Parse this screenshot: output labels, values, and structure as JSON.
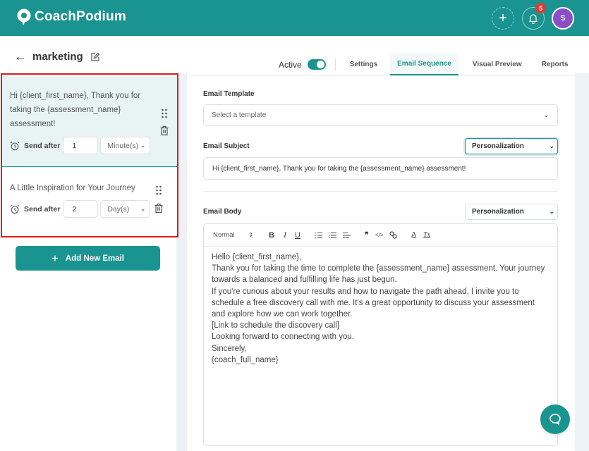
{
  "app": {
    "brand": "CoachPodium",
    "notification_count": "5",
    "avatar_initial": "S",
    "accent_color": "#1a9490",
    "highlight_color": "#e31b1b"
  },
  "header": {
    "back_icon": "arrow-left-icon",
    "title": "marketing",
    "edit_icon": "edit-icon"
  },
  "status": {
    "label": "Active",
    "enabled": true
  },
  "tabs": [
    {
      "label": "Settings",
      "selected": false
    },
    {
      "label": "Email Sequence",
      "selected": true
    },
    {
      "label": "Visual Preview",
      "selected": false
    },
    {
      "label": "Reports",
      "selected": false
    }
  ],
  "sequence": {
    "items": [
      {
        "subject": "Hi {client_first_name}, Thank you for taking the {assessment_name} assessment!",
        "send_after_label": "Send after",
        "value": "1",
        "unit": "Minute(s)",
        "selected": true
      },
      {
        "subject": "A Little Inspiration for Your Journey",
        "send_after_label": "Send after",
        "value": "2",
        "unit": "Day(s)",
        "selected": false
      }
    ],
    "add_button": "Add New Email"
  },
  "form": {
    "template_label": "Email Template",
    "template_placeholder": "Select a template",
    "subject_label": "Email Subject",
    "subject_personalization": "Personalization",
    "subject_value": "Hi {client_first_name}, Thank you for taking the {assessment_name} assessment!",
    "body_label": "Email Body",
    "body_personalization": "Personalization",
    "toolbar": {
      "format": "Normal",
      "buttons": [
        "bold",
        "italic",
        "underline",
        "ordered-list",
        "bullet-list",
        "align",
        "blockquote",
        "code",
        "link",
        "text-color",
        "clear-format"
      ]
    },
    "body_lines": [
      "Hello {client_first_name},",
      "Thank you for taking the time to complete the {assessment_name} assessment. Your journey towards a balanced and fulfilling life has just begun.",
      "If you're curious about your results and how to navigate the path ahead, I invite you to schedule a free discovery call with me. It's a great opportunity to discuss your assessment and explore how we can work together.",
      "[Link to schedule the discovery call]",
      "Looking forward to connecting with you.",
      "Sincerely,",
      "{coach_full_name}"
    ]
  }
}
